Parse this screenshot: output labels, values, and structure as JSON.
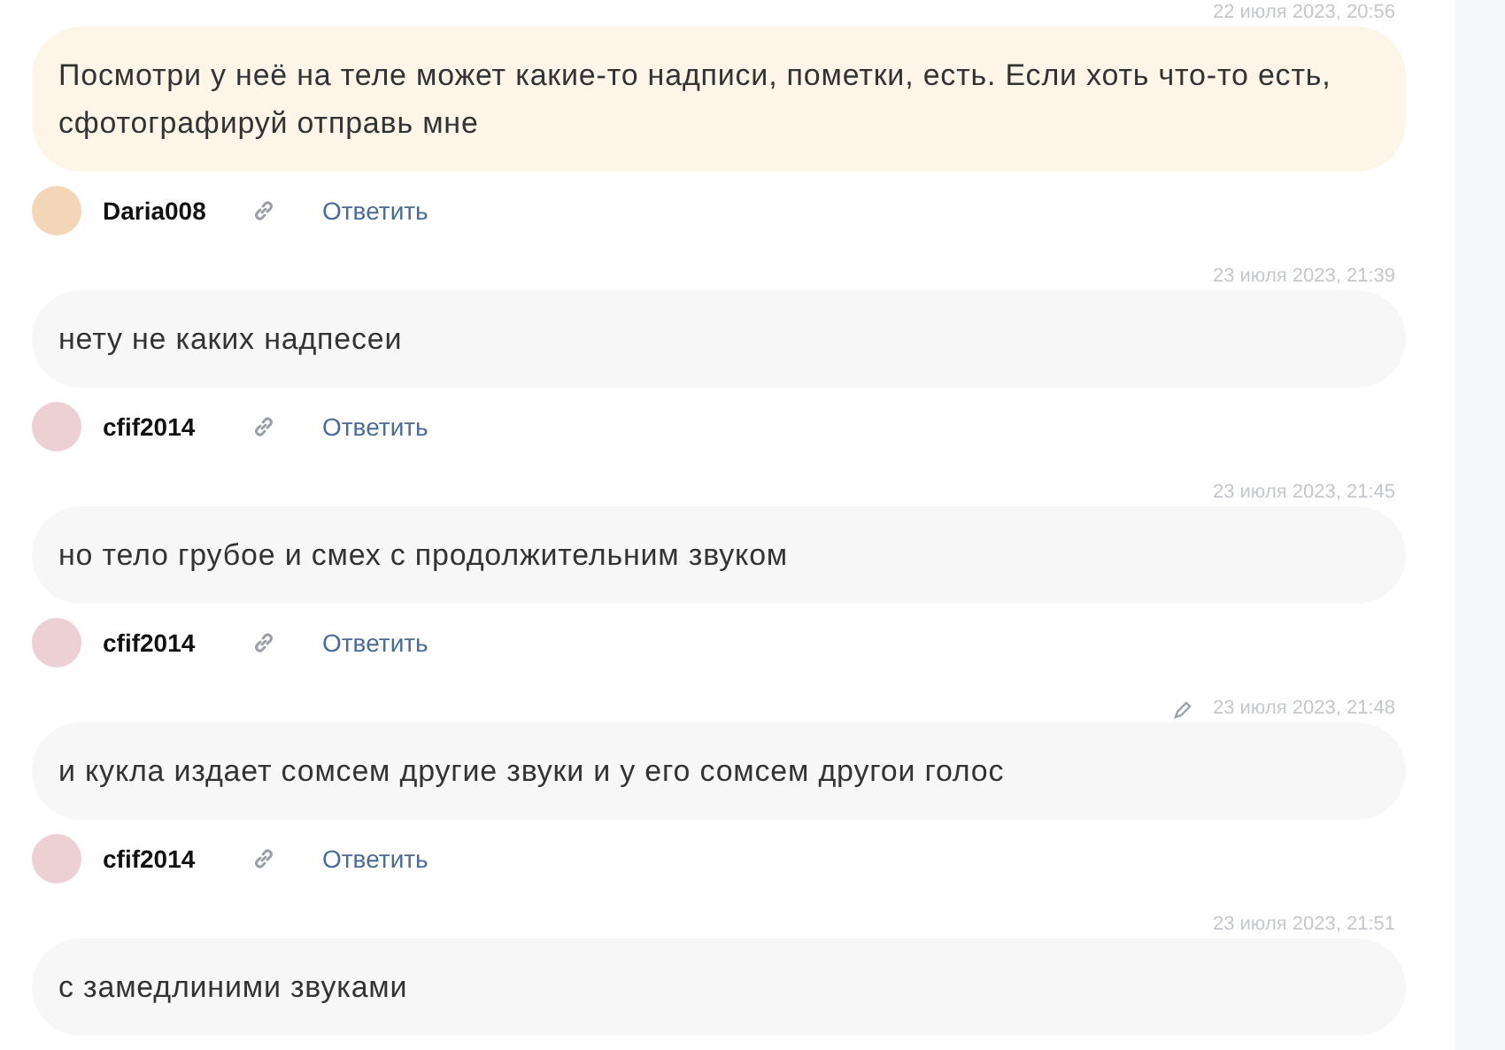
{
  "comments": [
    {
      "date": "22 июля 2023, 20:56",
      "edited": false,
      "highlighted": true,
      "text": "Посмотри у неё на теле может какие-то надписи, пометки, есть. Если хоть что-то есть, сфотографируй отправь мне",
      "author": "Daria008",
      "reply": "Ответить"
    },
    {
      "date": "23 июля 2023, 21:39",
      "edited": false,
      "highlighted": false,
      "text": "нету не каких надпесеи",
      "author": "cfif2014",
      "reply": "Ответить"
    },
    {
      "date": "23 июля 2023, 21:45",
      "edited": false,
      "highlighted": false,
      "text": "но тело грубое и смех с продолжительним звуком",
      "author": "cfif2014",
      "reply": "Ответить"
    },
    {
      "date": "23 июля 2023, 21:48",
      "edited": true,
      "highlighted": false,
      "text": "и кукла издает сомсем другие звуки и у его сомсем другои голос",
      "author": "cfif2014",
      "reply": "Ответить"
    },
    {
      "date": "23 июля 2023, 21:51",
      "edited": false,
      "highlighted": false,
      "text": "с замедлиними звуками"
    }
  ]
}
